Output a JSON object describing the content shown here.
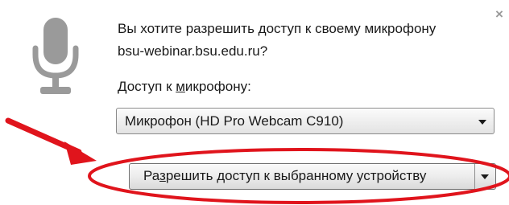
{
  "prompt": {
    "question_line1": "Вы хотите разрешить доступ к своему микрофону",
    "question_line2": "bsu-webinar.bsu.edu.ru?",
    "mic_label_pre": "Доступ к ",
    "mic_label_underlined": "м",
    "mic_label_post": "икрофону:"
  },
  "device_select": {
    "selected": "Микрофон (HD Pro Webcam C910)"
  },
  "allow_button": {
    "label_pre": "Ра",
    "label_underlined": "з",
    "label_post": "решить доступ к выбранному устройству"
  },
  "close_glyph": "×",
  "icons": {
    "microphone": "microphone-icon",
    "close": "close-icon",
    "select_arrow": "chevron-down-icon",
    "split_arrow": "chevron-down-icon"
  },
  "colors": {
    "mic_icon": "#9a9a9a",
    "annotation": "#e0141c"
  }
}
